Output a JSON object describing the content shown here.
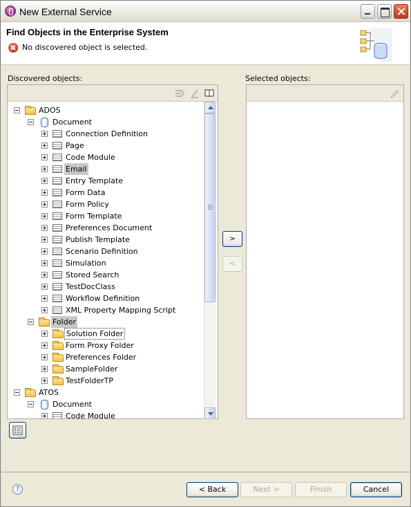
{
  "window": {
    "title": "New External Service"
  },
  "banner": {
    "heading": "Find Objects in the Enterprise System",
    "message": "No discovered object is selected."
  },
  "discovered": {
    "label": "Discovered objects:",
    "tree": [
      {
        "label": "ADOS",
        "level": 0,
        "icon": "folder-icon",
        "expanded": true
      },
      {
        "label": "Document",
        "level": 1,
        "icon": "database-icon",
        "expanded": true
      },
      {
        "label": "Connection Definition",
        "level": 2,
        "icon": "table-icon",
        "expanded": false
      },
      {
        "label": "Page",
        "level": 2,
        "icon": "table-icon",
        "expanded": false
      },
      {
        "label": "Code Module",
        "level": 2,
        "icon": "table-icon",
        "expanded": false
      },
      {
        "label": "Email",
        "level": 2,
        "icon": "table-icon",
        "expanded": false,
        "selected": true
      },
      {
        "label": "Entry Template",
        "level": 2,
        "icon": "table-icon",
        "expanded": false
      },
      {
        "label": "Form Data",
        "level": 2,
        "icon": "table-icon",
        "expanded": false
      },
      {
        "label": "Form Policy",
        "level": 2,
        "icon": "table-icon",
        "expanded": false
      },
      {
        "label": "Form Template",
        "level": 2,
        "icon": "table-icon",
        "expanded": false
      },
      {
        "label": "Preferences Document",
        "level": 2,
        "icon": "table-icon",
        "expanded": false
      },
      {
        "label": "Publish Template",
        "level": 2,
        "icon": "table-icon",
        "expanded": false
      },
      {
        "label": "Scenario Definition",
        "level": 2,
        "icon": "table-icon",
        "expanded": false
      },
      {
        "label": "Simulation",
        "level": 2,
        "icon": "table-icon",
        "expanded": false
      },
      {
        "label": "Stored Search",
        "level": 2,
        "icon": "table-icon",
        "expanded": false
      },
      {
        "label": "TestDocClass",
        "level": 2,
        "icon": "table-icon",
        "expanded": false
      },
      {
        "label": "Workflow Definition",
        "level": 2,
        "icon": "table-icon",
        "expanded": false
      },
      {
        "label": "XML Property Mapping Script",
        "level": 2,
        "icon": "table-icon",
        "expanded": false
      },
      {
        "label": "Folder",
        "level": 1,
        "icon": "folder-icon",
        "expanded": true,
        "selected": true
      },
      {
        "label": "Solution Folder",
        "level": 2,
        "icon": "folder-icon",
        "expanded": false,
        "focused": true
      },
      {
        "label": "Form Proxy Folder",
        "level": 2,
        "icon": "folder-icon",
        "expanded": false
      },
      {
        "label": "Preferences Folder",
        "level": 2,
        "icon": "folder-icon",
        "expanded": false
      },
      {
        "label": "SampleFolder",
        "level": 2,
        "icon": "folder-icon",
        "expanded": false
      },
      {
        "label": "TestFolderTP",
        "level": 2,
        "icon": "folder-icon",
        "expanded": false
      },
      {
        "label": "ATOS",
        "level": 0,
        "icon": "folder-icon",
        "expanded": true
      },
      {
        "label": "Document",
        "level": 1,
        "icon": "database-icon",
        "expanded": true
      },
      {
        "label": "Code Module",
        "level": 2,
        "icon": "table-icon",
        "expanded": false
      }
    ]
  },
  "selected": {
    "label": "Selected objects:"
  },
  "arrows": {
    "add": ">",
    "remove": "<"
  },
  "help": "?",
  "buttons": {
    "back": "< Back",
    "next": "Next >",
    "finish": "Finish",
    "cancel": "Cancel"
  }
}
